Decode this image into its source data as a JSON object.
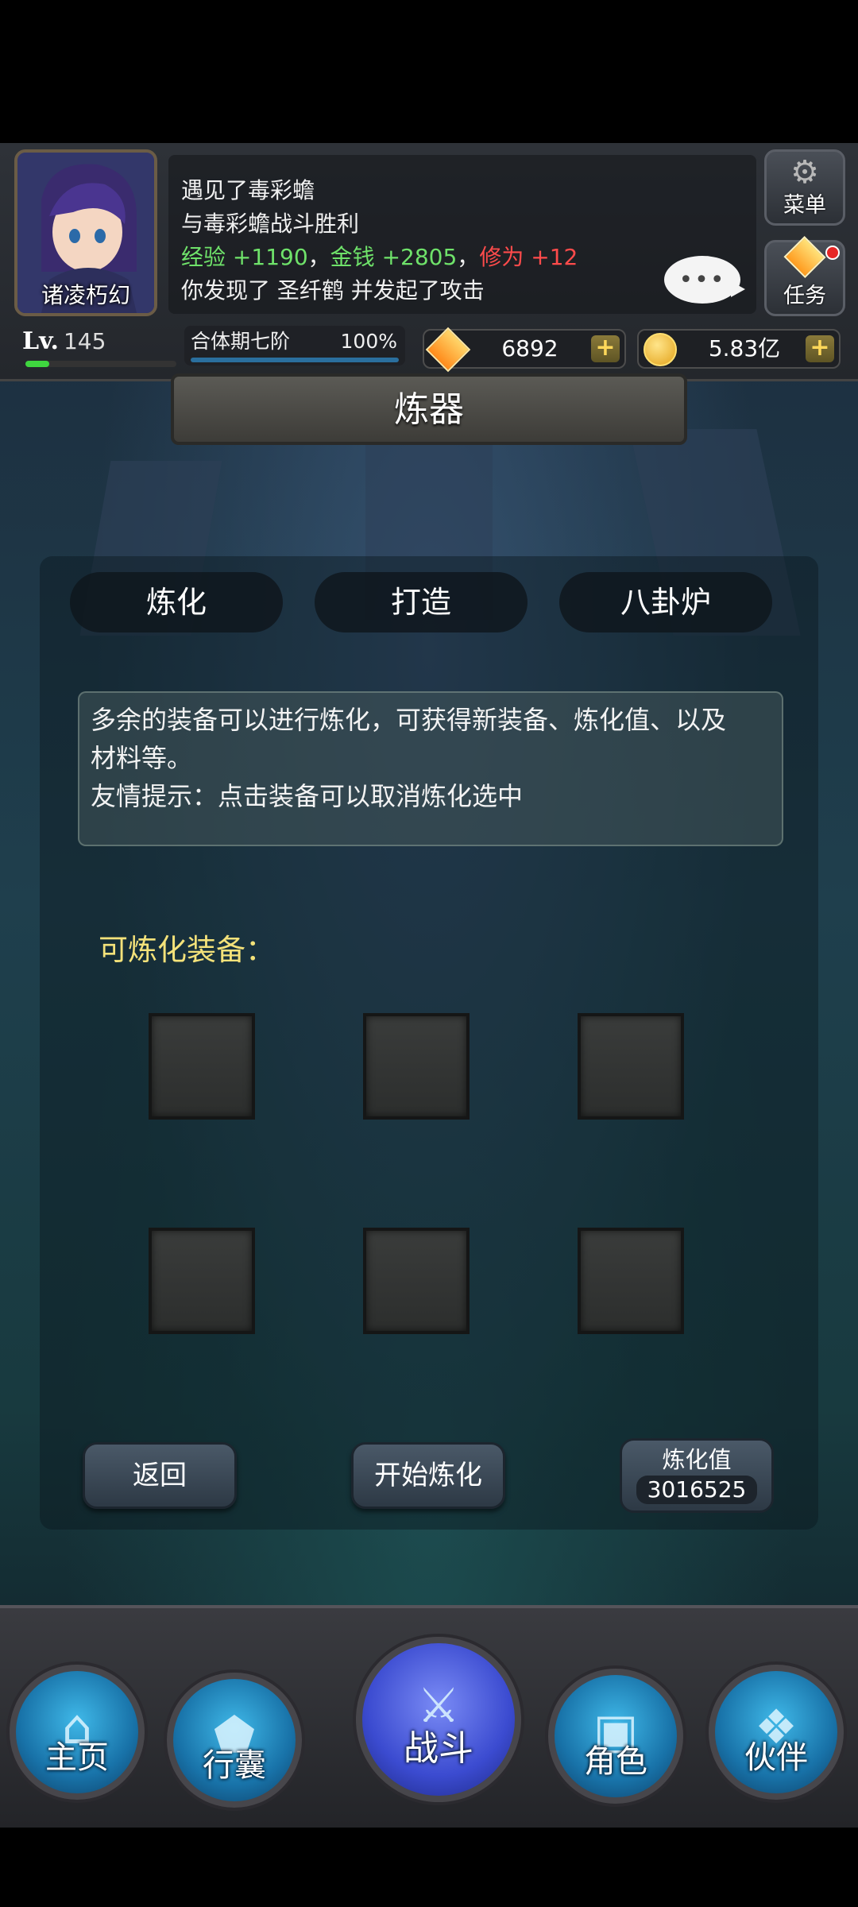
{
  "player": {
    "name": "诸凌朽幻",
    "level_label": "Lv.",
    "level": "145",
    "realm": "合体期七阶",
    "realm_progress": "100%",
    "level_progress": 0.16
  },
  "log": {
    "line1": "遇见了毒彩蟾",
    "line2": "与毒彩蟾战斗胜利",
    "line3_exp_label": "经验",
    "line3_exp_value": "+1190",
    "line3_sep1": "，",
    "line3_gold_label": "金钱",
    "line3_gold_value": "+2805",
    "line3_sep2": "，",
    "line3_cult_label": "修为",
    "line3_cult_value": "+12",
    "line4": "你发现了 圣纤鹤 并发起了攻击",
    "chat_label": "•••"
  },
  "side_buttons": {
    "menu": "菜单",
    "task": "任务"
  },
  "currency": {
    "gems": "6892",
    "gold": "5.83亿",
    "plus": "+"
  },
  "page": {
    "title": "炼器"
  },
  "tabs": [
    {
      "label": "炼化"
    },
    {
      "label": "打造"
    },
    {
      "label": "八卦炉"
    }
  ],
  "info": {
    "line1": "多余的装备可以进行炼化，可获得新装备、炼化值、以及",
    "line2": "材料等。",
    "line3": "友情提示：点击装备可以取消炼化选中"
  },
  "equipment": {
    "label": "可炼化装备："
  },
  "actions": {
    "back": "返回",
    "start": "开始炼化",
    "value_label": "炼化值",
    "value": "3016525"
  },
  "nav": [
    {
      "label": "主页"
    },
    {
      "label": "行囊"
    },
    {
      "label": "战斗"
    },
    {
      "label": "角色"
    },
    {
      "label": "伙伴"
    }
  ],
  "colors": {
    "exp_green": "#6fe26a",
    "cult_red": "#ff4b4b",
    "equip_label_yellow": "#f4e27a"
  }
}
